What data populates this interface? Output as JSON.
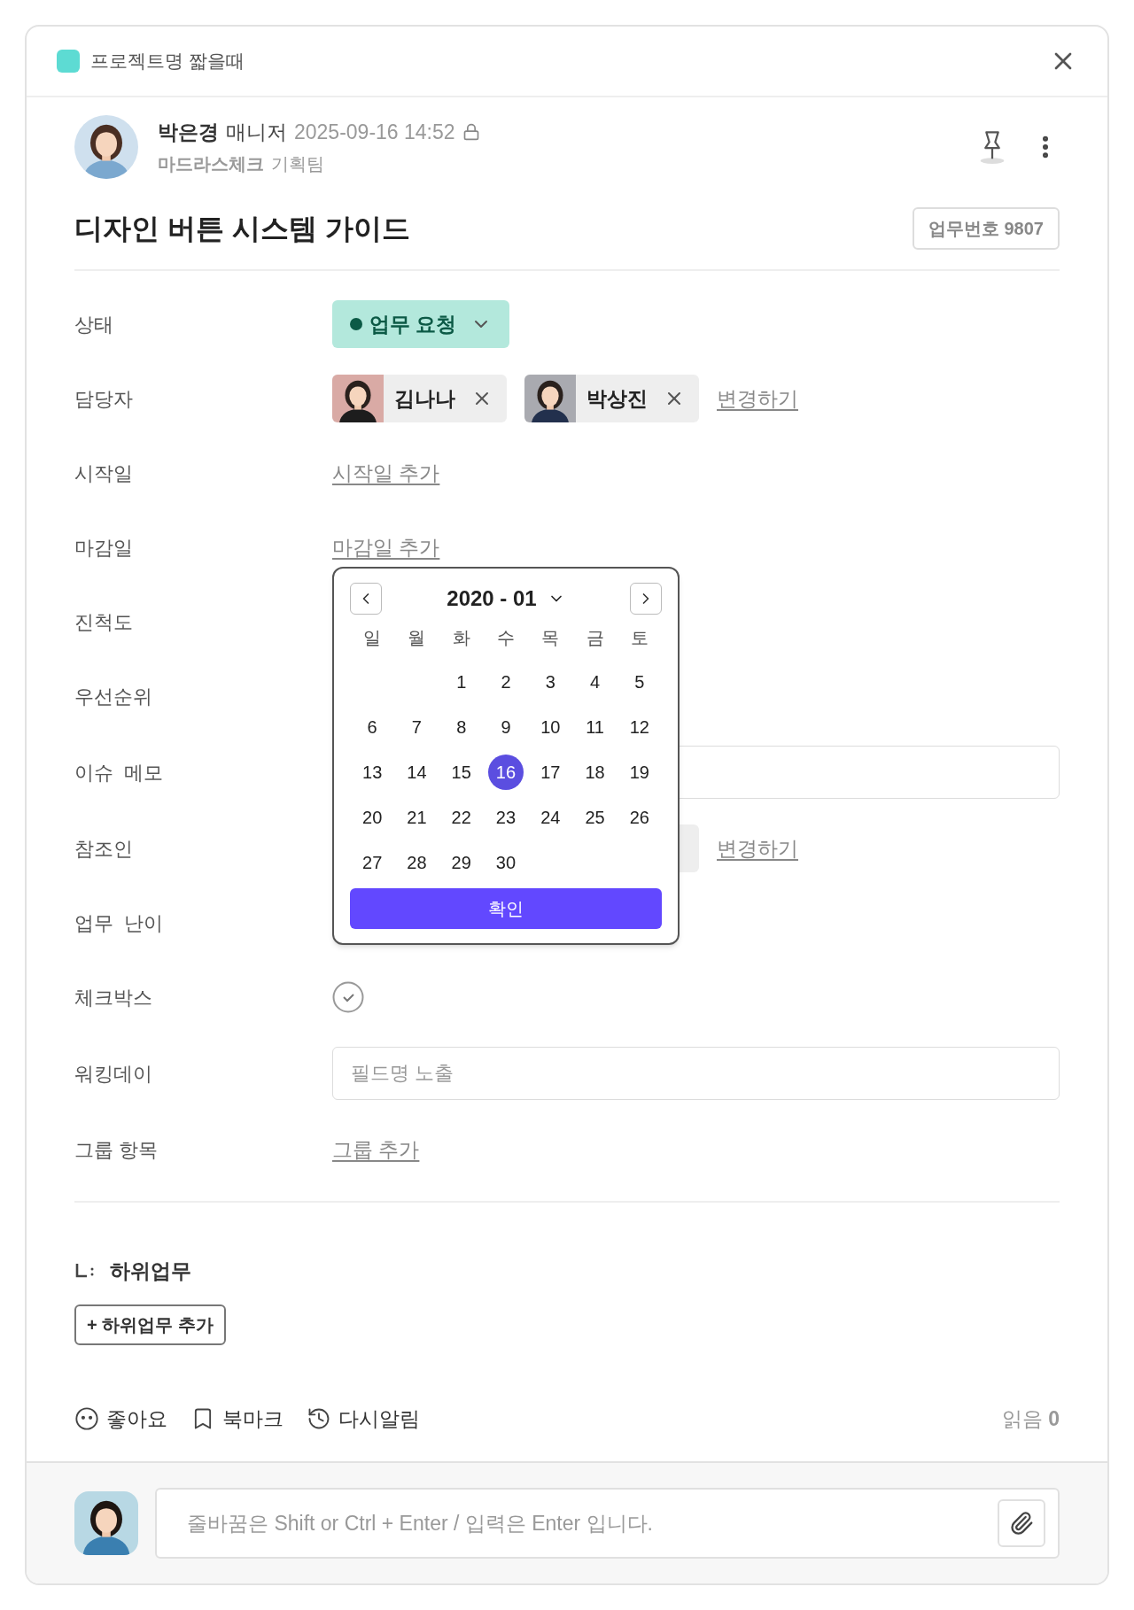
{
  "header": {
    "project_name": "프로젝트명 짧을때"
  },
  "author": {
    "name": "박은경",
    "role": "매니저",
    "datetime": "2025-09-16 14:52",
    "company": "마드라스체크",
    "team": "기획팀"
  },
  "task": {
    "title": "디자인 버튼 시스템 가이드",
    "number_badge": "업무번호 9807"
  },
  "fields": [
    {
      "kind": "status",
      "label": "상태",
      "value": "업무 요청"
    },
    {
      "kind": "people",
      "label": "담당자",
      "people": [
        {
          "name": "김나나"
        },
        {
          "name": "박상진"
        }
      ],
      "action": "변경하기"
    },
    {
      "kind": "link",
      "label": "시작일",
      "link": "시작일 추가"
    },
    {
      "kind": "link",
      "label": "마감일",
      "link": "마감일 추가"
    },
    {
      "kind": "empty",
      "label": "진척도"
    },
    {
      "kind": "empty",
      "label": "우선순위"
    },
    {
      "kind": "input",
      "label": "이슈  메모"
    },
    {
      "kind": "covered_people",
      "label": "참조인",
      "action": "변경하기"
    },
    {
      "kind": "empty",
      "label": "업무  난이"
    },
    {
      "kind": "checkbox",
      "label": "체크박스"
    },
    {
      "kind": "input",
      "label": "워킹데이",
      "placeholder": "필드명 노출"
    },
    {
      "kind": "link",
      "label": "그룹 항목",
      "link": "그룹 추가"
    }
  ],
  "calendar": {
    "title": "2020 - 01",
    "weekdays": [
      "일",
      "월",
      "화",
      "수",
      "목",
      "금",
      "토"
    ],
    "weeks": [
      {
        "kind": "leading",
        "days": [
          {
            "label": "1",
            "selected": false
          },
          {
            "label": "2",
            "selected": false
          },
          {
            "label": "3",
            "selected": false
          },
          {
            "label": "4",
            "selected": false
          },
          {
            "label": "5",
            "selected": false
          }
        ]
      },
      {
        "kind": "full",
        "days": [
          {
            "label": "6",
            "selected": false
          },
          {
            "label": "7",
            "selected": false
          },
          {
            "label": "8",
            "selected": false
          },
          {
            "label": "9",
            "selected": false
          },
          {
            "label": "10",
            "selected": false
          },
          {
            "label": "11",
            "selected": false
          },
          {
            "label": "12",
            "selected": false
          }
        ]
      },
      {
        "kind": "full",
        "days": [
          {
            "label": "13",
            "selected": false
          },
          {
            "label": "14",
            "selected": false
          },
          {
            "label": "15",
            "selected": false
          },
          {
            "label": "16",
            "selected": true
          },
          {
            "label": "17",
            "selected": false
          },
          {
            "label": "18",
            "selected": false
          },
          {
            "label": "19",
            "selected": false
          }
        ]
      },
      {
        "kind": "full",
        "days": [
          {
            "label": "20",
            "selected": false
          },
          {
            "label": "21",
            "selected": false
          },
          {
            "label": "22",
            "selected": false
          },
          {
            "label": "23",
            "selected": false
          },
          {
            "label": "24",
            "selected": false
          },
          {
            "label": "25",
            "selected": false
          },
          {
            "label": "26",
            "selected": false
          }
        ]
      },
      {
        "kind": "trailing",
        "days": [
          {
            "label": "27",
            "selected": false
          },
          {
            "label": "28",
            "selected": false
          },
          {
            "label": "29",
            "selected": false
          },
          {
            "label": "30",
            "selected": false
          }
        ]
      }
    ],
    "confirm": "확인"
  },
  "subtasks": {
    "title": "하위업무",
    "add_button": "+ 하위업무 추가"
  },
  "actions": [
    {
      "kind": "like",
      "label": "좋아요"
    },
    {
      "kind": "bookmark",
      "label": "북마크"
    },
    {
      "kind": "remind",
      "label": "다시알림"
    }
  ],
  "read": {
    "label": "읽음",
    "count": "0"
  },
  "comment": {
    "placeholder": "줄바꿈은 Shift or Ctrl + Enter / 입력은 Enter 입니다."
  }
}
